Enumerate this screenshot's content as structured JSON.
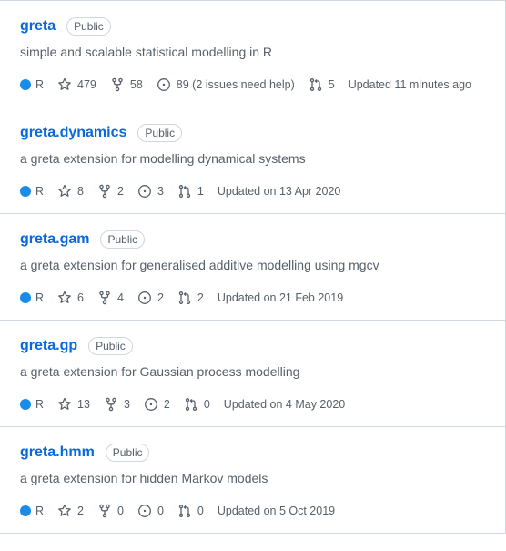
{
  "colors": {
    "link": "#0969da",
    "lang_R": "#198CE7",
    "muted": "#57606a",
    "border": "#d0d7de"
  },
  "icons": {
    "star": "star-icon",
    "fork": "repo-forked-icon",
    "issue": "issue-opened-icon",
    "pr": "git-pull-request-icon"
  },
  "repos": [
    {
      "name": "greta",
      "visibility": "Public",
      "description": "simple and scalable statistical modelling in R",
      "language": "R",
      "stars": "479",
      "forks": "58",
      "issues": "89 (2 issues need help)",
      "pulls": "5",
      "updated": "Updated 11 minutes ago"
    },
    {
      "name": "greta.dynamics",
      "visibility": "Public",
      "description": "a greta extension for modelling dynamical systems",
      "language": "R",
      "stars": "8",
      "forks": "2",
      "issues": "3",
      "pulls": "1",
      "updated": "Updated on 13 Apr 2020"
    },
    {
      "name": "greta.gam",
      "visibility": "Public",
      "description": "a greta extension for generalised additive modelling using mgcv",
      "language": "R",
      "stars": "6",
      "forks": "4",
      "issues": "2",
      "pulls": "2",
      "updated": "Updated on 21 Feb 2019"
    },
    {
      "name": "greta.gp",
      "visibility": "Public",
      "description": "a greta extension for Gaussian process modelling",
      "language": "R",
      "stars": "13",
      "forks": "3",
      "issues": "2",
      "pulls": "0",
      "updated": "Updated on 4 May 2020"
    },
    {
      "name": "greta.hmm",
      "visibility": "Public",
      "description": "a greta extension for hidden Markov models",
      "language": "R",
      "stars": "2",
      "forks": "0",
      "issues": "0",
      "pulls": "0",
      "updated": "Updated on 5 Oct 2019"
    }
  ]
}
